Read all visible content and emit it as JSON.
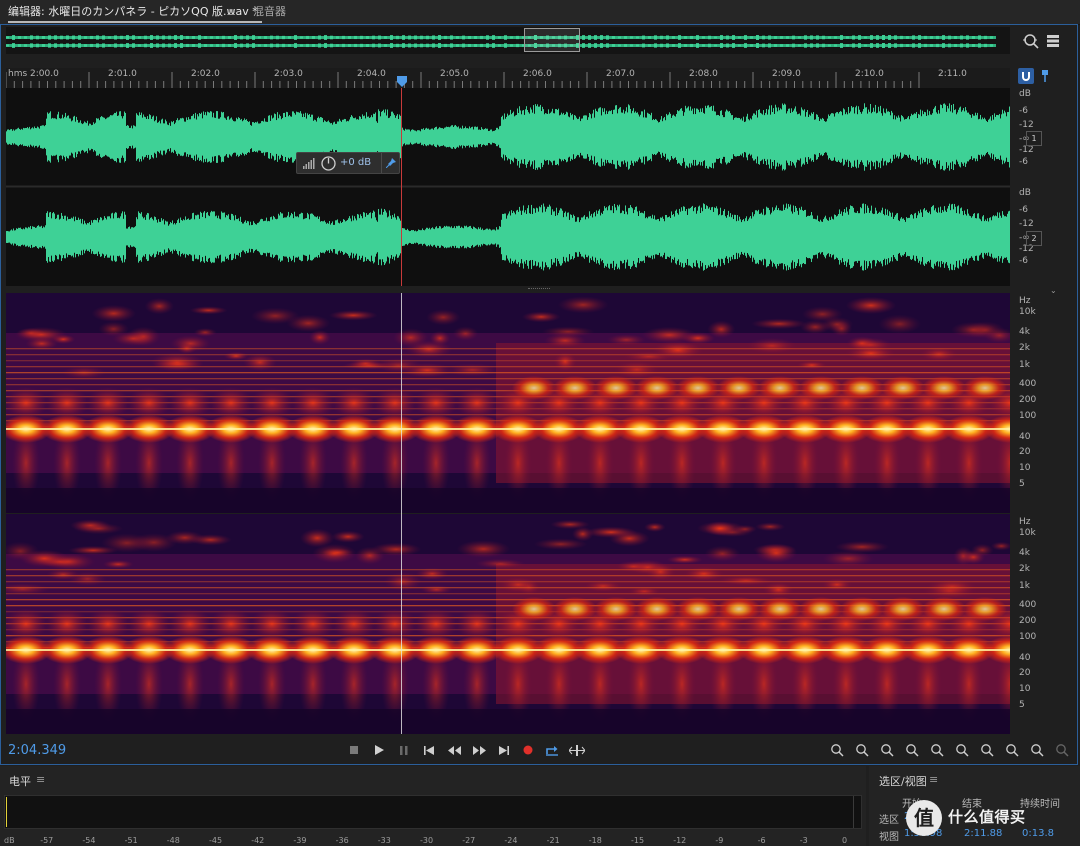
{
  "tabs": {
    "editor_label": "编辑器: 水曜日のカンパネラ - ピカソQQ 版.wav *",
    "editor_menu": "≡",
    "mixer_label": "混音器"
  },
  "colors": {
    "waveform": "#3ed196",
    "accent_blue": "#4f9be8",
    "record_red": "#e0302a",
    "playhead": "#c73a3a"
  },
  "ruler": {
    "labels": [
      "hms 2:00.0",
      "2:01.0",
      "2:02.0",
      "2:03.0",
      "2:04.0",
      "2:05.0",
      "2:06.0",
      "2:07.0",
      "2:08.0",
      "2:09.0",
      "2:10.0",
      "2:11.0"
    ]
  },
  "waveform": {
    "db_labels": [
      "dB",
      "-6",
      "-12",
      "-∞",
      "-12",
      "-6"
    ],
    "channels": [
      "1",
      "2"
    ]
  },
  "hud": {
    "volume": "+0 dB"
  },
  "spectrum": {
    "hz_labels": [
      "Hz",
      "10k",
      "4k",
      "2k",
      "1k",
      "400",
      "200",
      "100",
      "40",
      "20",
      "10",
      "5"
    ]
  },
  "transport": {
    "timecode": "2:04.349"
  },
  "level_panel": {
    "title": "电平",
    "menu": "≡",
    "scale": [
      "dB",
      "-57",
      "-54",
      "-51",
      "-48",
      "-45",
      "-42",
      "-39",
      "-36",
      "-33",
      "-30",
      "-27",
      "-24",
      "-21",
      "-18",
      "-15",
      "-12",
      "-9",
      "-6",
      "-3",
      "0"
    ]
  },
  "selection_panel": {
    "title": "选区/视图",
    "menu": "≡",
    "headers": [
      "开始",
      "结束",
      "持续时间"
    ],
    "rows": [
      {
        "label": "选区",
        "start": "2",
        "end": "",
        "duration": ""
      },
      {
        "label": "视图",
        "start": "1:57.98",
        "end": "2:11.88",
        "duration": "0:13.8"
      }
    ]
  },
  "watermark": {
    "badge": "值",
    "text": "什么值得买"
  }
}
